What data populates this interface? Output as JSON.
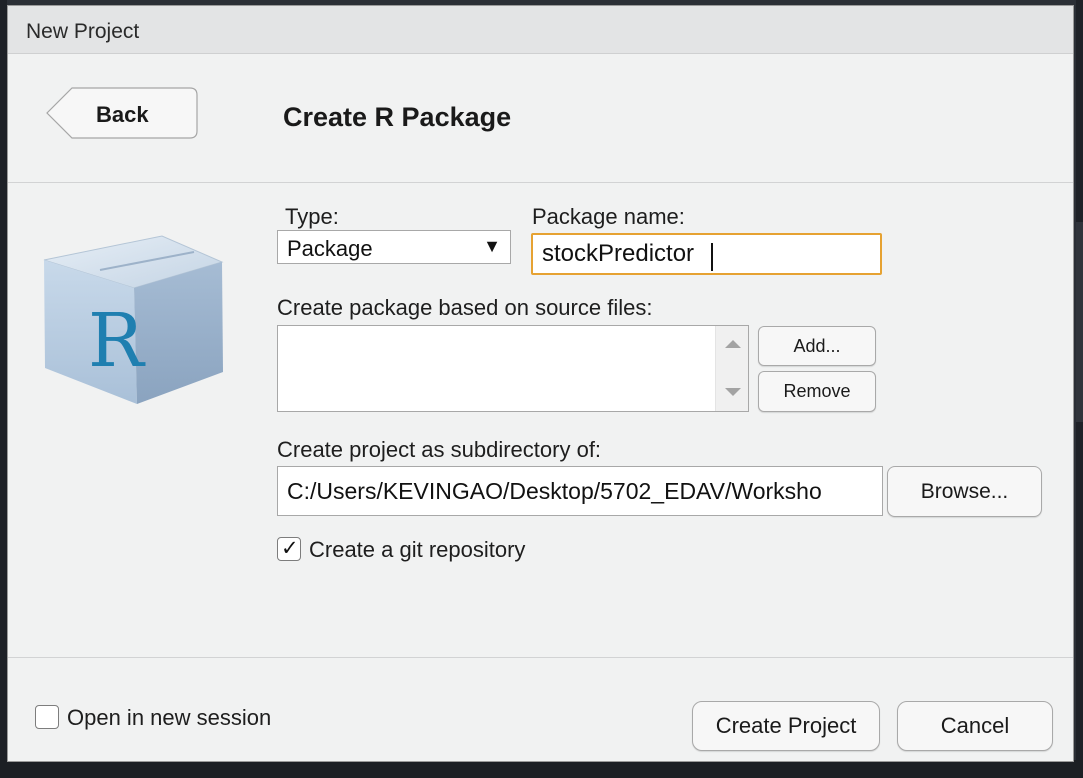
{
  "window": {
    "title": "New Project"
  },
  "header": {
    "back_label": "Back",
    "page_title": "Create R Package"
  },
  "form": {
    "type_label": "Type:",
    "type_value": "Package",
    "package_name_label": "Package name:",
    "package_name_value": "stockPredictor",
    "source_files_label": "Create package based on source files:",
    "add_label": "Add...",
    "remove_label": "Remove",
    "subdir_label": "Create project as subdirectory of:",
    "subdir_value": "C:/Users/KEVINGAO/Desktop/5702_EDAV/Worksho",
    "browse_label": "Browse...",
    "git_label": "Create a git repository",
    "git_checked": true
  },
  "footer": {
    "new_session_label": "Open in new session",
    "new_session_checked": false,
    "create_label": "Create Project",
    "cancel_label": "Cancel"
  },
  "icons": {
    "package": "r-package-icon",
    "back": "back-arrow-icon",
    "dropdown": "dropdown-arrow-icon",
    "check": "check-icon",
    "scroll_up": "scroll-up-icon",
    "scroll_down": "scroll-down-icon"
  },
  "colors": {
    "focus_border": "#e6a232",
    "r_letter": "#1f7fb0",
    "dialog_bg": "#f1f2f2"
  }
}
